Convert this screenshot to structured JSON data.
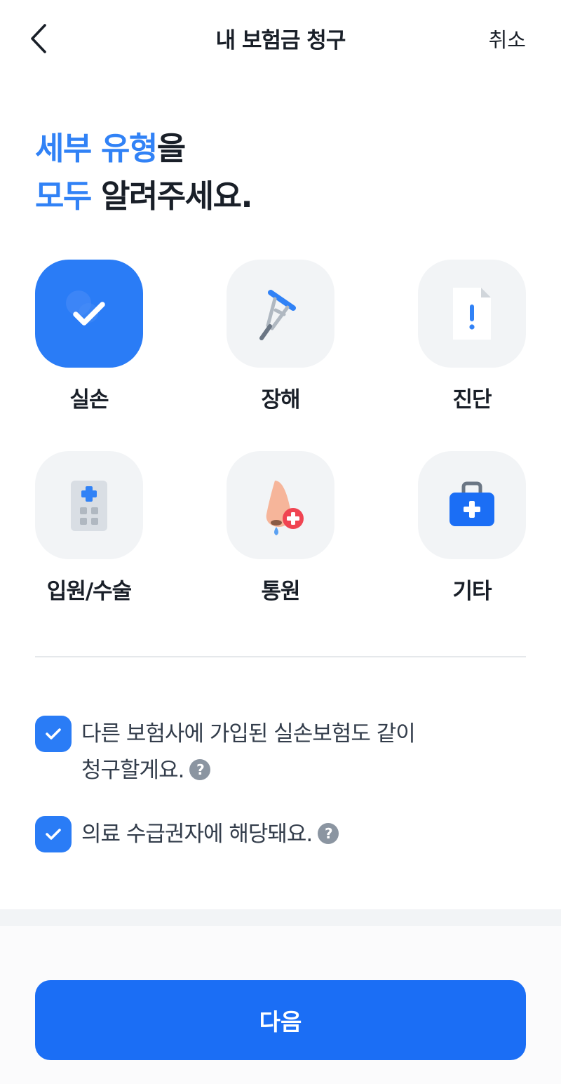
{
  "header": {
    "title": "내 보험금 청구",
    "cancel_label": "취소",
    "back_icon": "chevron-left-icon"
  },
  "headline": {
    "line1_highlight": "세부 유형",
    "line1_rest": "을",
    "line2_highlight": "모두",
    "line2_rest": " 알려주세요."
  },
  "options": [
    {
      "label": "실손",
      "icon": "check-icon",
      "selected": true
    },
    {
      "label": "장해",
      "icon": "crutch-icon",
      "selected": false
    },
    {
      "label": "진단",
      "icon": "document-alert-icon",
      "selected": false
    },
    {
      "label": "입원/수술",
      "icon": "hospital-building-icon",
      "selected": false
    },
    {
      "label": "통원",
      "icon": "nose-clinic-icon",
      "selected": false
    },
    {
      "label": "기타",
      "icon": "first-aid-kit-icon",
      "selected": false
    }
  ],
  "checks": [
    {
      "text_line1": "다른 보험사에 가입된 실손보험도 같이",
      "text_line2": "청구할게요.",
      "checked": true
    },
    {
      "text_line1": "의료 수급권자에 해당돼요.",
      "checked": true
    }
  ],
  "help_glyph": "?",
  "next_label": "다음",
  "colors": {
    "accent": "#3182f6",
    "primary_button": "#1b6ef5",
    "tile_background": "#f2f4f6",
    "text_dark": "#191f28"
  }
}
